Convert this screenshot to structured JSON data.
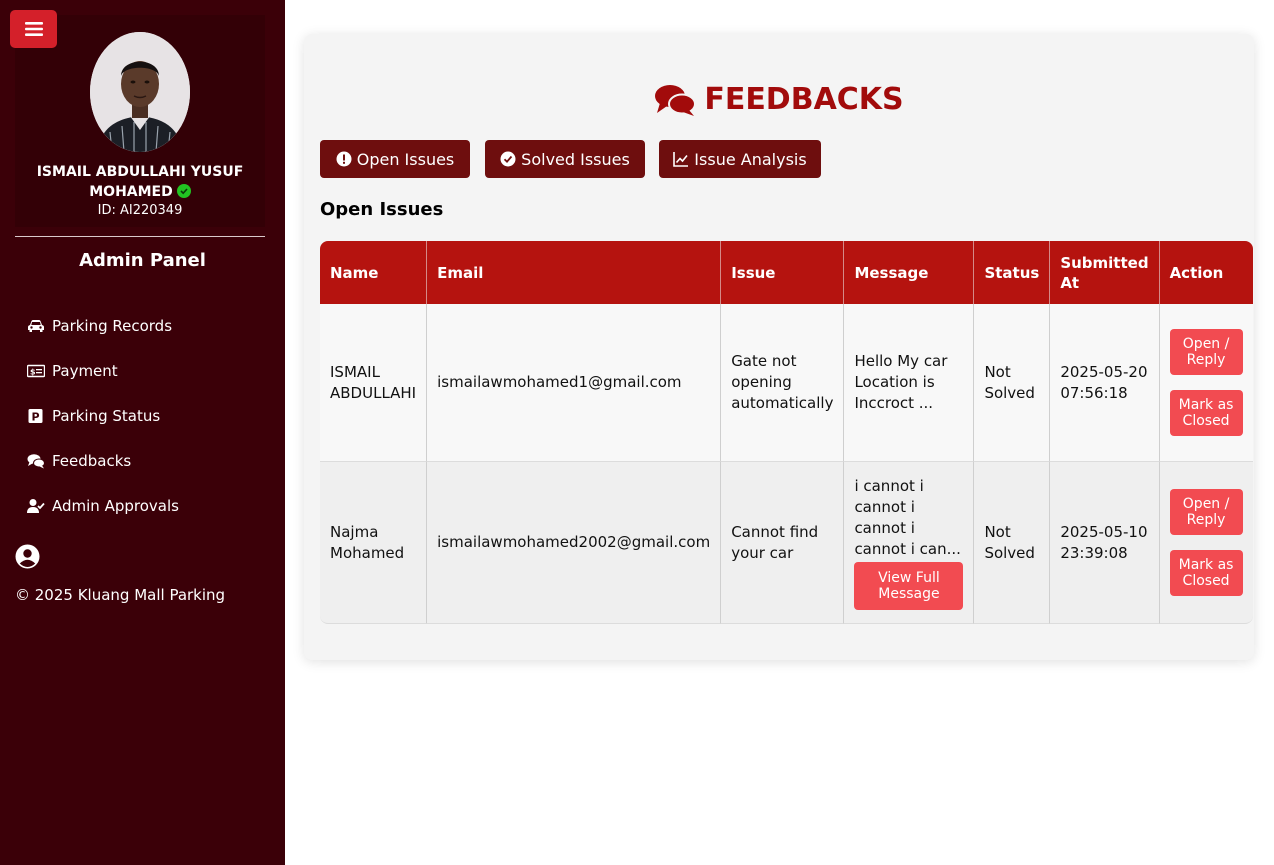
{
  "sidebar": {
    "profile": {
      "name": "ISMAIL ABDULLAHI YUSUF MOHAMED",
      "id_text": "ID: AI220349"
    },
    "panel_title": "Admin Panel",
    "nav": [
      {
        "label": "Parking Records",
        "icon": "car-icon"
      },
      {
        "label": "Payment",
        "icon": "money-bill-icon"
      },
      {
        "label": "Parking Status",
        "icon": "parking-sign-icon"
      },
      {
        "label": "Feedbacks",
        "icon": "comments-icon"
      },
      {
        "label": "Admin Approvals",
        "icon": "user-check-icon"
      }
    ],
    "copyright": "© 2025 Kluang Mall Parking"
  },
  "main": {
    "title": "FEEDBACKS",
    "tabs": [
      {
        "label": "Open Issues",
        "icon": "exclamation-circle-icon"
      },
      {
        "label": "Solved Issues",
        "icon": "check-circle-icon"
      },
      {
        "label": "Issue Analysis",
        "icon": "line-chart-icon"
      }
    ],
    "section_title": "Open Issues",
    "table": {
      "headers": [
        "Name",
        "Email",
        "Issue",
        "Message",
        "Status",
        "Submitted At",
        "Action"
      ],
      "rows": [
        {
          "name": "ISMAIL ABDULLAHI",
          "email": "ismailawmohamed1@gmail.com",
          "issue": "Gate not opening automatically",
          "message": "Hello My car Location is Inccroct ...",
          "status": "Not Solved",
          "submitted": "2025-05-20 07:56:18",
          "open_label": "Open / Reply",
          "close_label": "Mark as Closed"
        },
        {
          "name": "Najma Mohamed",
          "email": "ismailawmohamed2002@gmail.com",
          "issue": "Cannot find your car",
          "message": "i cannot i cannot i cannot i cannot i can...",
          "view_label": "View Full Message",
          "status": "Not Solved",
          "submitted": "2025-05-10 23:39:08",
          "open_label": "Open / Reply",
          "close_label": "Mark as Closed"
        }
      ]
    }
  },
  "colors": {
    "sidebar_bg": "#3b0008",
    "accent": "#a20b0b",
    "header_red": "#b5130f",
    "action_red": "#f24b51",
    "tab_bg": "#6e0e0e"
  }
}
